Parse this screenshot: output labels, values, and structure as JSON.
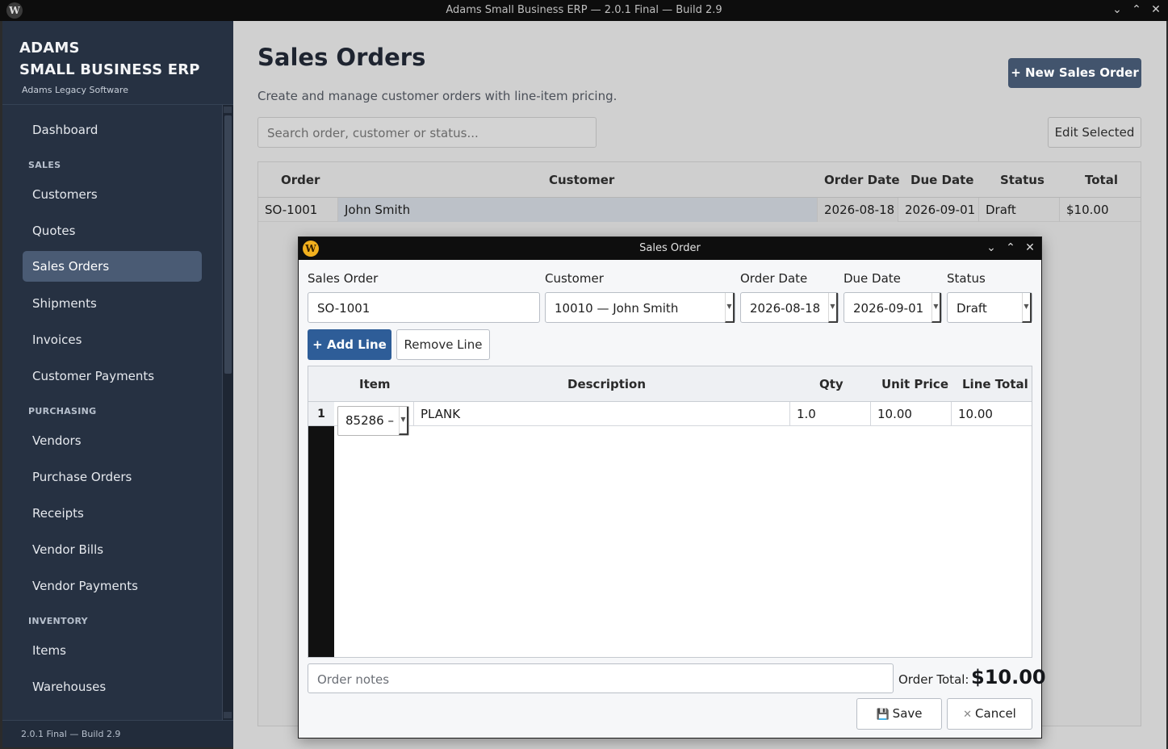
{
  "window": {
    "title": "Adams Small Business ERP — 2.0.1 Final — Build 2.9",
    "logo_letter": "W",
    "controls": [
      "chevron-down",
      "chevron-up",
      "close"
    ]
  },
  "sidebar": {
    "brand_line1": "ADAMS",
    "brand_line2": "SMALL BUSINESS ERP",
    "brand_sub": "Adams Legacy Software",
    "items": {
      "dashboard": "Dashboard",
      "sales_section": "SALES",
      "customers": "Customers",
      "quotes": "Quotes",
      "sales_orders": "Sales Orders",
      "shipments": "Shipments",
      "invoices": "Invoices",
      "customer_payments": "Customer Payments",
      "purchasing_section": "PURCHASING",
      "vendors": "Vendors",
      "purchase_orders": "Purchase Orders",
      "receipts": "Receipts",
      "vendor_bills": "Vendor Bills",
      "vendor_payments": "Vendor Payments",
      "inventory_section": "INVENTORY",
      "items": "Items",
      "warehouses": "Warehouses"
    },
    "active": "Sales Orders",
    "footer": "2.0.1 Final — Build 2.9"
  },
  "main": {
    "title": "Sales Orders",
    "subtitle": "Create and manage customer orders with line-item pricing.",
    "new_button": "+  New Sales Order",
    "search_placeholder": "Search order, customer or status...",
    "edit_button": "Edit Selected",
    "columns": {
      "order": "Order",
      "customer": "Customer",
      "order_date": "Order Date",
      "due_date": "Due Date",
      "status": "Status",
      "total": "Total"
    },
    "rows": [
      {
        "order": "SO-1001",
        "customer": "John Smith",
        "order_date": "2026-08-18",
        "due_date": "2026-09-01",
        "status": "Draft",
        "total": "$10.00"
      }
    ]
  },
  "dialog": {
    "title": "Sales Order",
    "logo_letter": "W",
    "labels": {
      "sales_order": "Sales Order",
      "customer": "Customer",
      "order_date": "Order Date",
      "due_date": "Due Date",
      "status": "Status"
    },
    "values": {
      "sales_order": "SO-1001",
      "customer": "10010 — John Smith",
      "order_date": "2026-08-18",
      "due_date": "2026-09-01",
      "status": "Draft"
    },
    "add_line": "+ Add Line",
    "remove_line": "Remove Line",
    "line_columns": {
      "item": "Item",
      "description": "Description",
      "qty": "Qty",
      "unit_price": "Unit Price",
      "line_total": "Line Total"
    },
    "lines": [
      {
        "num": "1",
        "item": "85286 –",
        "description": "PLANK",
        "qty": "1.0",
        "unit_price": "10.00",
        "line_total": "10.00"
      }
    ],
    "notes_placeholder": "Order notes",
    "order_total_label": "Order Total:",
    "order_total_value": "$10.00",
    "save": "Save",
    "cancel": "Cancel"
  }
}
